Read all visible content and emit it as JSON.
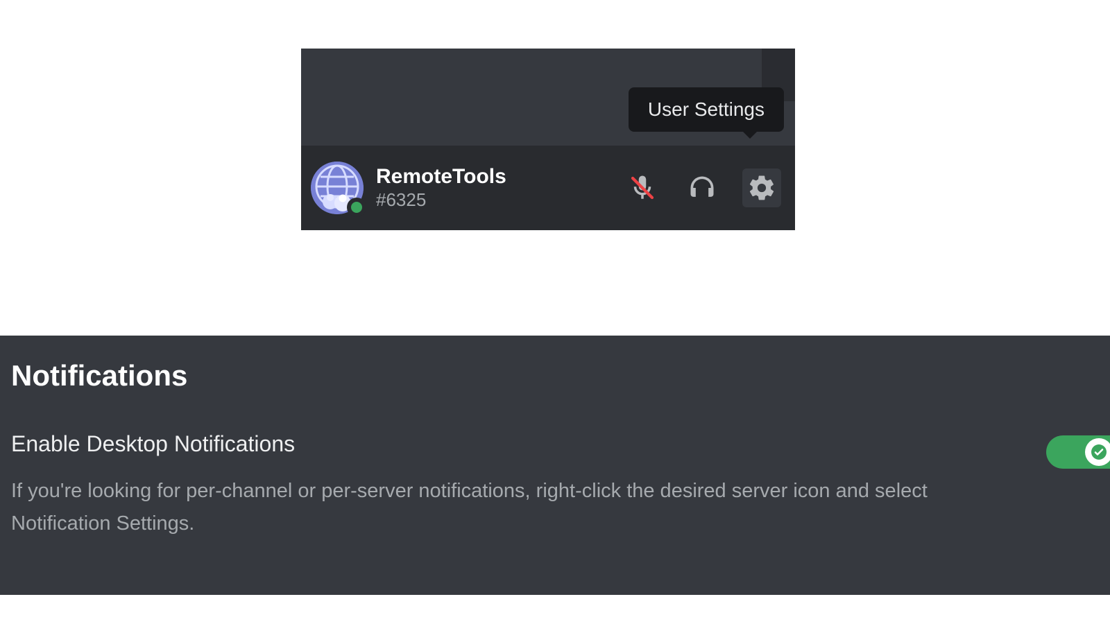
{
  "userPanel": {
    "tooltip": "User Settings",
    "username": "RemoteTools",
    "discriminator": "#6325"
  },
  "settings": {
    "sectionTitle": "Notifications",
    "desktopNotifications": {
      "label": "Enable Desktop Notifications",
      "description": "If you're looking for per-channel or per-server notifications, right-click the desired server icon and select Notification Settings.",
      "enabled": true
    }
  },
  "colors": {
    "bgDark": "#36393f",
    "bgDarker": "#292b2f",
    "tooltipBg": "#18191c",
    "textMuted": "#a6aaae",
    "online": "#3ba55d",
    "toggleOn": "#3ba55d"
  }
}
